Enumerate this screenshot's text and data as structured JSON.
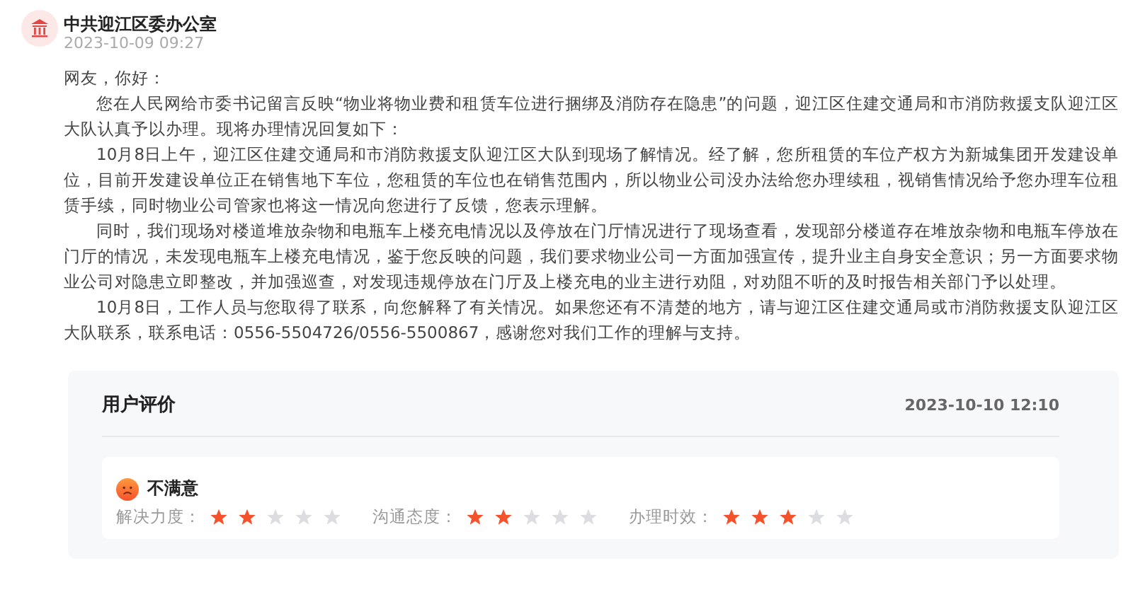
{
  "reply": {
    "author": "中共迎江区委办公室",
    "time": "2023-10-09 09:27",
    "greeting": "网友，你好：",
    "paragraphs": [
      "您在人民网给市委书记留言反映“物业将物业费和租赁车位进行捆绑及消防存在隐患”的问题，迎江区住建交通局和市消防救援支队迎江区大队认真予以办理。现将办理情况回复如下：",
      "10月8日上午，迎江区住建交通局和市消防救援支队迎江区大队到现场了解情况。经了解，您所租赁的车位产权方为新城集团开发建设单位，目前开发建设单位正在销售地下车位，您租赁的车位也在销售范围内，所以物业公司没办法给您办理续租，视销售情况给予您办理车位租赁手续，同时物业公司管家也将这一情况向您进行了反馈，您表示理解。",
      "同时，我们现场对楼道堆放杂物和电瓶车上楼充电情况以及停放在门厅情况进行了现场查看，发现部分楼道存在堆放杂物和电瓶车停放在门厅的情况，未发现电瓶车上楼充电情况，鉴于您反映的问题，我们要求物业公司一方面加强宣传，提升业主自身安全意识；另一方面要求物业公司对隐患立即整改，并加强巡查，对发现违规停放在门厅及上楼充电的业主进行劝阻，对劝阻不听的及时报告相关部门予以处理。",
      "10月8日，工作人员与您取得了联系，向您解释了有关情况。如果您还有不清楚的地方，请与迎江区住建交通局或市消防救援支队迎江区大队联系，联系电话：0556-5504726/0556-5500867，感谢您对我们工作的理解与支持。"
    ]
  },
  "evaluation": {
    "title": "用户评价",
    "time": "2023-10-10 12:10",
    "verdict": "不满意",
    "ratings": [
      {
        "label": "解决力度：",
        "stars": 2
      },
      {
        "label": "沟通态度：",
        "stars": 2
      },
      {
        "label": "办理时效：",
        "stars": 3
      }
    ]
  }
}
